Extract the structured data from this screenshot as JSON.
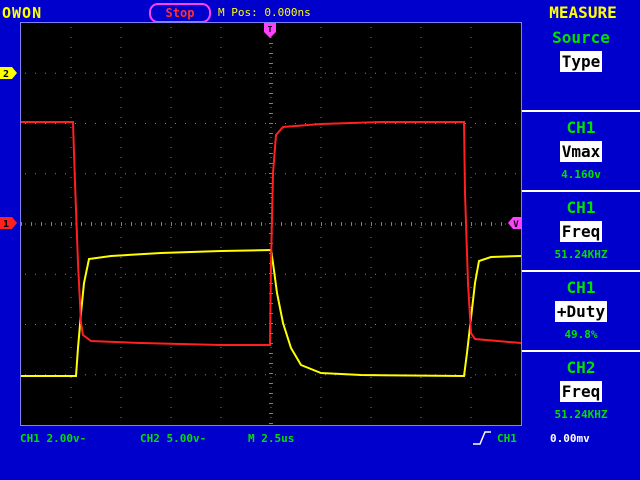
{
  "header": {
    "brand": "OWON",
    "run_state": "Stop",
    "position": "M Pos: 0.000ns",
    "panel_title": "MEASURE"
  },
  "markers": {
    "ch2": "2",
    "ch1": "1",
    "trigger": "T",
    "level": "V"
  },
  "measure": {
    "source_label": "Source",
    "type_label": "Type",
    "items": [
      {
        "channel": "CH1",
        "type": "Vmax",
        "value": "4.160v"
      },
      {
        "channel": "CH1",
        "type": "Freq",
        "value": "51.24KHZ"
      },
      {
        "channel": "CH1",
        "type": "+Duty",
        "value": "49.8%"
      },
      {
        "channel": "CH2",
        "type": "Freq",
        "value": "51.24KHZ"
      }
    ]
  },
  "footer": {
    "ch1_scale": "CH1 2.00v-",
    "ch2_scale": "CH2 5.00v-",
    "timebase": "M 2.5us",
    "trigger_source": "CH1",
    "trigger_level": "0.00mv"
  },
  "colors": {
    "ch1": "#ff2020",
    "ch2": "#ffff00",
    "grid": "#808080",
    "panel_bg": "#0000cc",
    "text": "#00e000"
  }
}
